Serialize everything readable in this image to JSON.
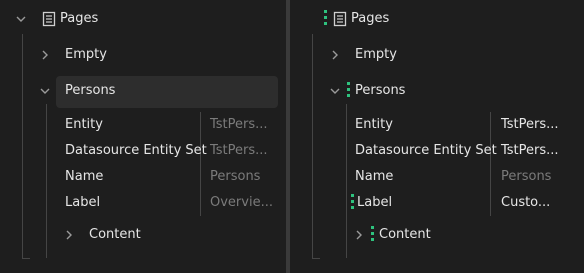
{
  "colors": {
    "background": "#1e1e1e",
    "selected_row": "#2d2d2d",
    "muted": "#7b7b7b",
    "drop_indicator": "#2ec27e"
  },
  "left": {
    "root_label": "Pages",
    "empty_label": "Empty",
    "persons_label": "Persons",
    "props": [
      {
        "name": "Entity",
        "value": "TstPers..."
      },
      {
        "name": "Datasource Entity Set",
        "value": "TstPers..."
      },
      {
        "name": "Name",
        "value": "Persons"
      },
      {
        "name": "Label",
        "value": "Overvie..."
      }
    ],
    "content_label": "Content"
  },
  "right": {
    "root_label": "Pages",
    "empty_label": "Empty",
    "persons_label": "Persons",
    "props": [
      {
        "name": "Entity",
        "value": "TstPers..."
      },
      {
        "name": "Datasource Entity Set",
        "value": "TstPers..."
      },
      {
        "name": "Name",
        "value": "Persons"
      },
      {
        "name": "Label",
        "value": "Custo..."
      }
    ],
    "content_label": "Content"
  }
}
